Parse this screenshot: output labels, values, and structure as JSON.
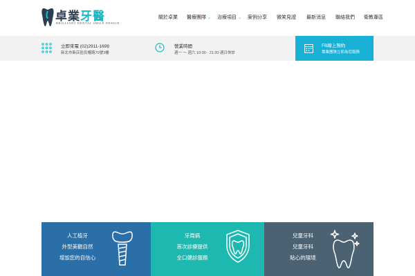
{
  "header": {
    "logo_title_main": "卓業",
    "logo_title_accent": "牙醫",
    "logo_subtitle": "BRILLIANT DENTAL SMILE DESIGN",
    "nav": [
      {
        "label": "關於卓業",
        "has_dropdown": false
      },
      {
        "label": "醫療團隊",
        "has_dropdown": true
      },
      {
        "label": "治療項目",
        "has_dropdown": true
      },
      {
        "label": "案例分享",
        "has_dropdown": false
      },
      {
        "label": "微笑見證",
        "has_dropdown": false
      },
      {
        "label": "最新消息",
        "has_dropdown": false
      },
      {
        "label": "聯絡我們",
        "has_dropdown": false
      },
      {
        "label": "衛教專區",
        "has_dropdown": false
      }
    ],
    "dropdown_glyph": "⌄"
  },
  "infobar": {
    "phone_line1": "立即來電 (02)2911-1698",
    "phone_line2": "新北市新店區民權路70號3樓",
    "hours_line1": "營業時間",
    "hours_line2": "週一 ～ 週六 10:00 - 21:30 週日休診",
    "fb_line1": "FB線上預約",
    "fb_line2": "專業團隊立即為您服務",
    "icons": {
      "phone": "dots-grid-icon",
      "hours": "clock-icon",
      "fb": "calendar-icon"
    }
  },
  "tiles": [
    {
      "lines": [
        "人工植牙",
        "外型美觀自然",
        "增加您的自信心"
      ],
      "color": "#2b6fa8",
      "icon": "dental-implant-icon"
    },
    {
      "lines": [
        "牙周病",
        "首次診療提供",
        "全口健診服務"
      ],
      "color": "#1db9b0",
      "icon": "tooth-shield-icon"
    },
    {
      "lines": [
        "兒童牙科",
        "兒童牙科",
        "貼心的環境"
      ],
      "color": "#4a6272",
      "icon": "sparkling-tooth-icon"
    }
  ],
  "colors": {
    "accent": "#19b7c6",
    "fb_blue": "#19b0d6",
    "infobar_bg": "#f2f2f2",
    "brand_dark": "#2d3e50"
  }
}
